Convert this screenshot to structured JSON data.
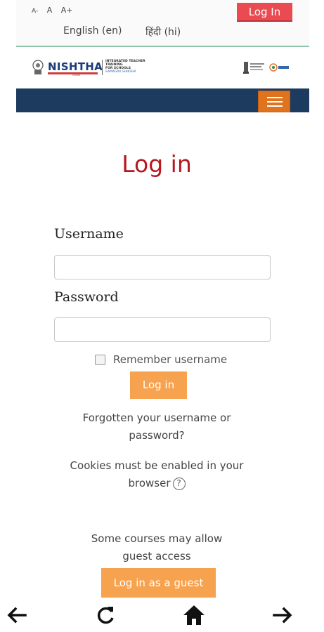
{
  "topbar": {
    "font_small": "A-",
    "font_normal": "A",
    "font_large": "A+",
    "login_button": "Log In",
    "lang_en": "English (en)",
    "lang_hi": "हिंदी (hi)"
  },
  "header": {
    "brand": "NISHTHA",
    "brand_sub": "ONLINE",
    "tagline_line1": "INTEGRATED TEACHER TRAINING",
    "tagline_line2": "FOR SCHOOLS",
    "tagline_line3": "SAMAGRA SHIKSHA"
  },
  "login": {
    "title": "Log in",
    "username_label": "Username",
    "username_value": "",
    "password_label": "Password",
    "password_value": "",
    "remember_label": "Remember username",
    "remember_checked": false,
    "login_button": "Log in",
    "forgot_line1": "Forgotten your username or",
    "forgot_line2": "password?",
    "cookies_line1": "Cookies must be enabled in your",
    "cookies_line2": "browser",
    "help_glyph": "?",
    "guest_line1": "Some courses may allow",
    "guest_line2": "guest access",
    "guest_button": "Log in as a guest"
  },
  "bottom_nav": {
    "back": "arrow-left-icon",
    "reload": "reload-icon",
    "home": "home-icon",
    "forward": "arrow-right-icon"
  },
  "colors": {
    "accent_red": "#e94b51",
    "title_red": "#b5181e",
    "navbar": "#1d3b5f",
    "menu_orange": "#e0731e",
    "button_orange": "#f7a24e"
  }
}
